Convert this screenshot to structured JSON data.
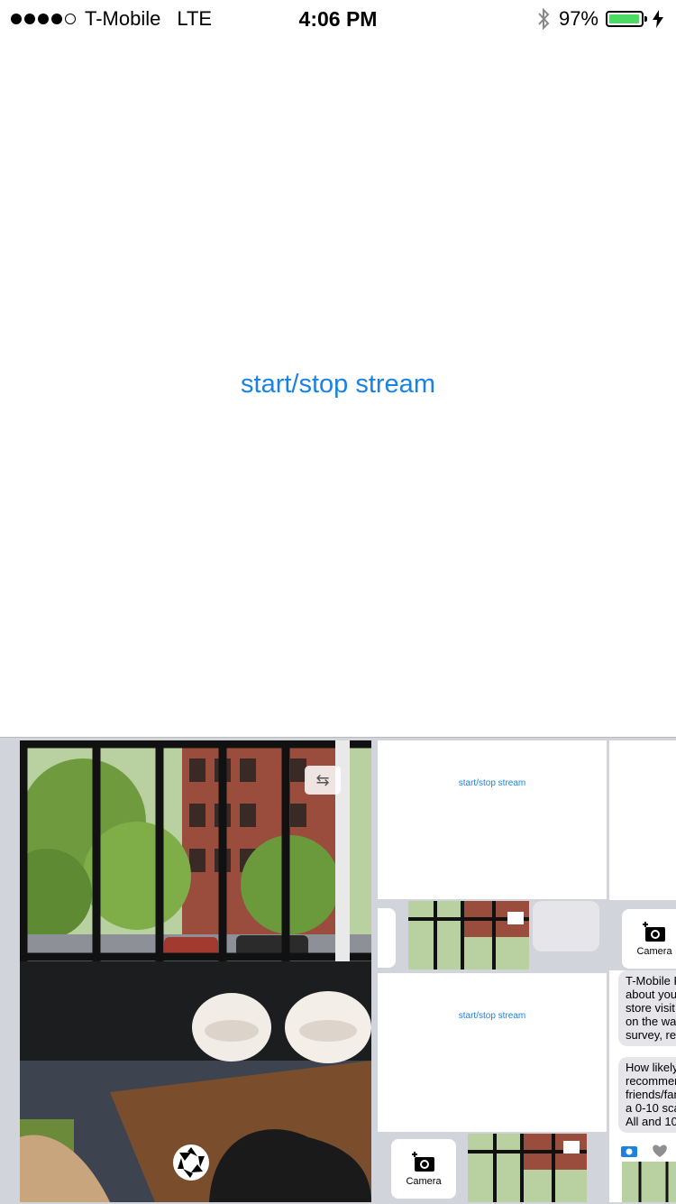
{
  "status_bar": {
    "carrier": "T-Mobile",
    "network": "LTE",
    "time": "4:06 PM",
    "battery_percent": "97%",
    "battery_level": 0.97,
    "signal_bars_filled": 4,
    "signal_bars_total": 5,
    "icons": [
      "bluetooth-icon",
      "battery-icon",
      "charging-bolt-icon"
    ]
  },
  "main": {
    "stream_button_label": "start/stop stream",
    "accent_color": "#1a82e2"
  },
  "tray": {
    "live_camera": {
      "icons": [
        "switch-camera-icon",
        "shutter-icon"
      ]
    },
    "thumbnails": [
      {
        "label": "start/stop stream",
        "camera_tile_label": ""
      },
      {
        "label": "start/stop stream",
        "camera_tile_label": "Camera"
      }
    ],
    "right_column": {
      "camera_tile_label": "Camera",
      "message_1": "T-Mobile F\nabout your\nstore visit!\non the way\nsurvey, rep",
      "message_2": "How likely\nrecommen\nfriends/fan\na 0-10 scal\nAll and 10="
    }
  }
}
